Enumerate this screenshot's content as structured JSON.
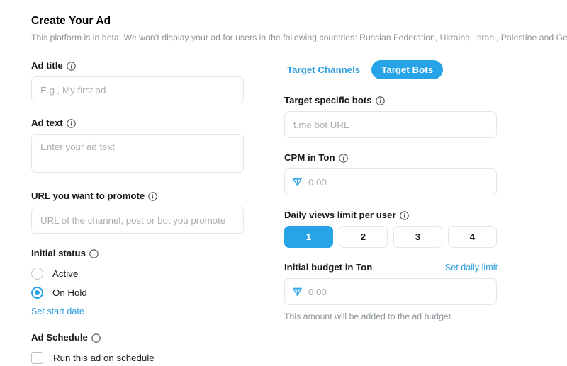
{
  "header": {
    "title": "Create Your Ad",
    "subtitle": "This platform is in beta. We won’t display your ad for users in the following countries: Russian Federation, Ukraine, Israel, Palestine and Germany."
  },
  "colors": {
    "accent": "#27a3e8",
    "link": "#2f9fe0",
    "text": "#16191c",
    "muted": "#8d9499",
    "placeholder": "#a9aeb2",
    "border": "#e4e7ea",
    "ton": "#2f9fe0"
  },
  "left_column": {
    "ad_title": {
      "label": "Ad title",
      "info_icon": "info-circle-icon",
      "value": "",
      "placeholder": "E.g., My first ad"
    },
    "ad_text": {
      "label": "Ad text",
      "info_icon": "info-circle-icon",
      "value": "",
      "placeholder": "Enter your ad text"
    },
    "promote_url": {
      "label": "URL you want to promote",
      "info_icon": "info-circle-icon",
      "value": "",
      "placeholder": "URL of the channel, post or bot you promote"
    },
    "initial_status": {
      "label": "Initial status",
      "info_icon": "info-circle-icon",
      "options": [
        {
          "label": "Active",
          "selected": false
        },
        {
          "label": "On Hold",
          "selected": true
        }
      ],
      "set_start_date_link": "Set start date"
    },
    "ad_schedule": {
      "label": "Ad Schedule",
      "info_icon": "info-circle-icon",
      "checkbox_label": "Run this ad on schedule",
      "checked": false
    }
  },
  "right_column": {
    "tabs": [
      {
        "label": "Target Channels",
        "active": false
      },
      {
        "label": "Target Bots",
        "active": true
      }
    ],
    "target_bots": {
      "label": "Target specific bots",
      "info_icon": "info-circle-icon",
      "value": "",
      "placeholder": "t.me bot URL"
    },
    "cpm": {
      "label": "CPM in Ton",
      "info_icon": "info-circle-icon",
      "currency_icon": "ton-coin-icon",
      "value": "",
      "placeholder": "0.00"
    },
    "daily_views": {
      "label": "Daily views limit per user",
      "info_icon": "info-circle-icon",
      "options": [
        "1",
        "2",
        "3",
        "4"
      ],
      "selected": "1"
    },
    "initial_budget": {
      "label": "Initial budget in Ton",
      "set_daily_limit_link": "Set daily limit",
      "currency_icon": "ton-coin-icon",
      "value": "",
      "placeholder": "0.00",
      "helper": "This amount will be added to the ad budget."
    }
  }
}
